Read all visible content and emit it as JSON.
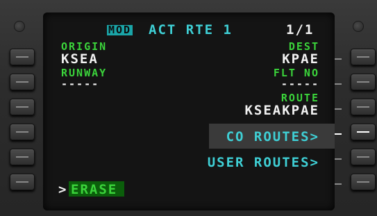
{
  "header": {
    "mod": "MOD",
    "title": "ACT RTE 1",
    "page": "1/1"
  },
  "left": {
    "origin_label": "ORIGIN",
    "origin_value": "KSEA",
    "runway_label": "RUNWAY",
    "runway_value": "-----",
    "erase_prompt": ">",
    "erase_label": "ERASE"
  },
  "right": {
    "dest_label": "DEST",
    "dest_value": "KPAE",
    "fltno_label": "FLT NO",
    "fltno_value": "-----",
    "route_label": "ROUTE",
    "route_value": "KSEAKPAE",
    "co_routes": "CO ROUTES>",
    "user_routes": "USER ROUTES>"
  },
  "colors": {
    "label": "#3bd43b",
    "value": "#f2f2f2",
    "prompt": "#3fd0d6",
    "mod_bg": "#1aa5a8"
  }
}
